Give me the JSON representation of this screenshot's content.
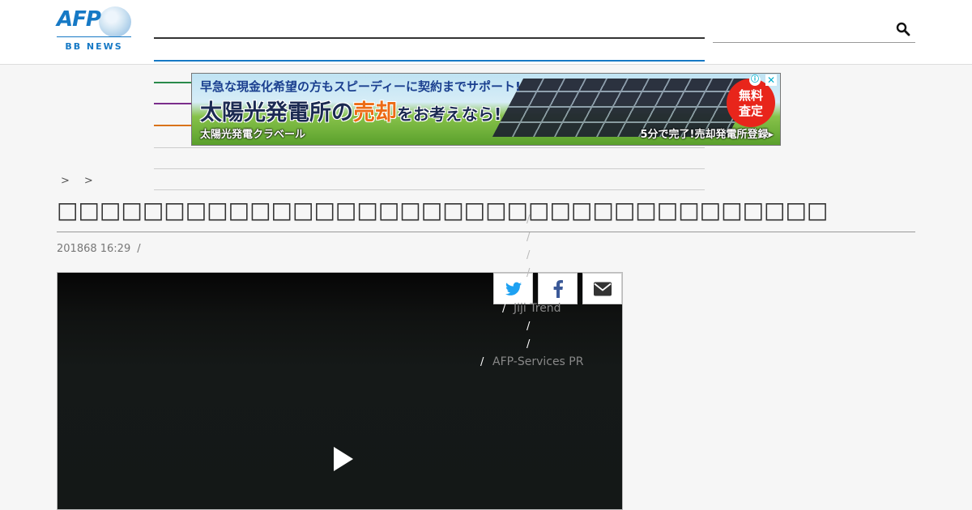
{
  "header": {
    "logo_text": "AFP",
    "logo_sub": "BB NEWS",
    "search_placeholder": "",
    "nav_colors": [
      "#333333",
      "#1679c5",
      "#2a8a4a",
      "#7b2d8b",
      "#d9731a",
      "#cccccc",
      "#cccccc",
      "#cccccc"
    ]
  },
  "ad": {
    "top_line": "早急な現金化希望の方もスピーディーに契約までサポート!",
    "main_a": "太陽光発電所の",
    "main_highlight": "売却",
    "main_b": "をお考えなら!",
    "brand": "太陽光発電クラベール",
    "cta": "5分で完了!売却発電所登録▸",
    "badge_line1": "無料",
    "badge_line2": "査定",
    "info_icon": "ⓘ",
    "close_icon": "✕"
  },
  "breadcrumb": {
    "sep1": ">",
    "sep2": ">"
  },
  "article": {
    "title": "□□□□□□□□□□□□□□□□□□□□□□□□□□□□□□□□□□□□",
    "date": "201868 16:29",
    "meta_sep": "/"
  },
  "share": {
    "twitter_icon": "twitter-icon",
    "facebook_icon": "facebook-icon",
    "email_icon": "envelope-icon"
  },
  "sidebar": {
    "slash": "/",
    "jiji_trend": "Jiji Trend",
    "afp_services": "AFP-Services PR"
  },
  "video": {
    "play_icon": "play-icon"
  }
}
